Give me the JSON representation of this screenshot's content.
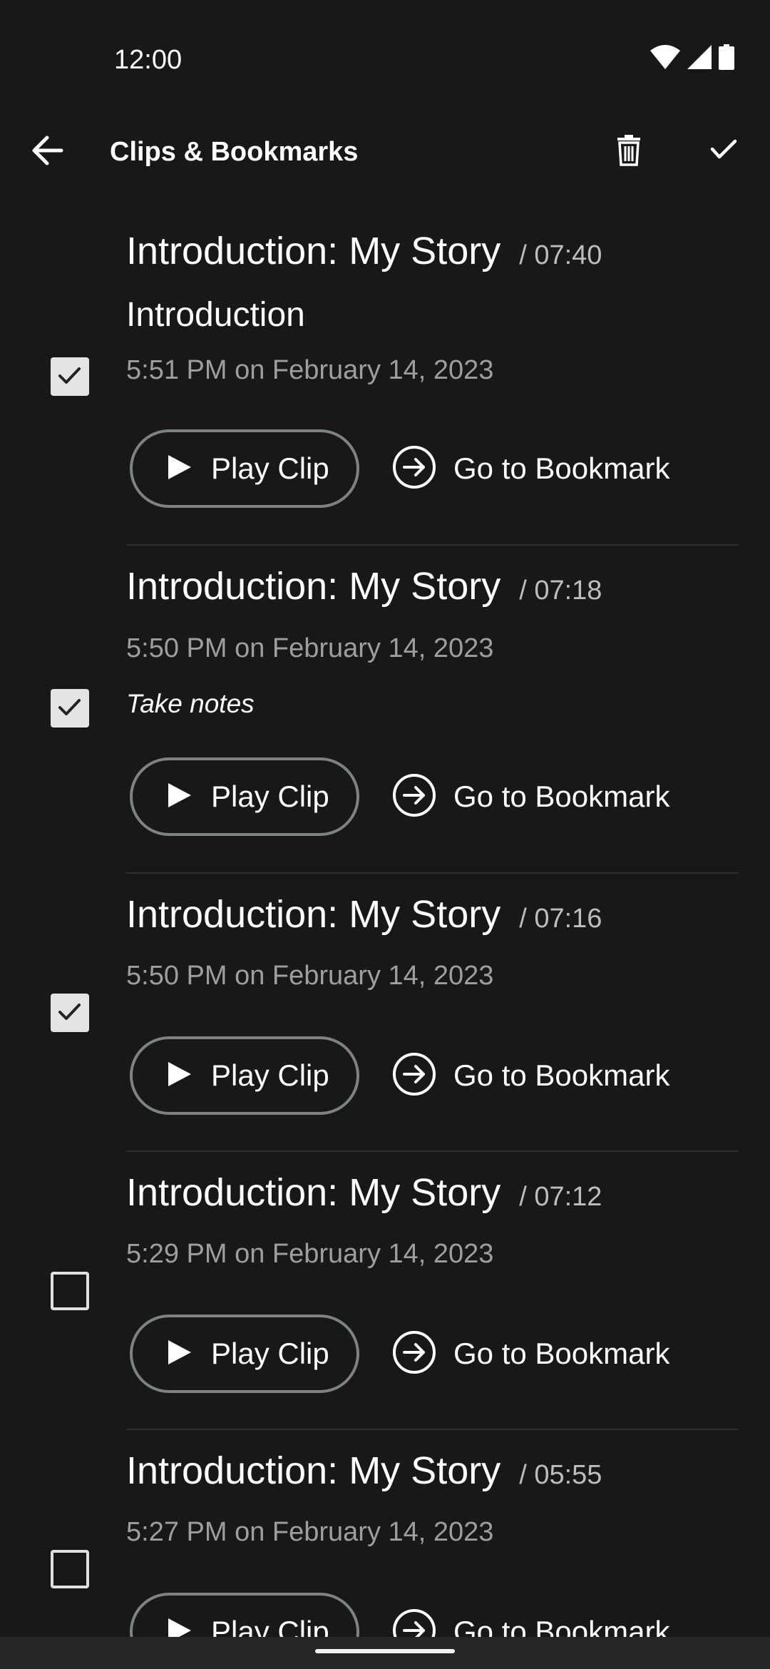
{
  "status_bar": {
    "time": "12:00"
  },
  "app_bar": {
    "title": "Clips & Bookmarks"
  },
  "colors": {
    "background": "#181818",
    "button_outline": "#7b8480",
    "secondary_text": "#9e9e9e"
  },
  "clips": [
    {
      "title": "Introduction: My Story",
      "duration": "/ 07:40",
      "name": "Introduction",
      "timestamp": "5:51 PM on February 14, 2023",
      "note": "",
      "checked": true,
      "play_label": "Play Clip",
      "bookmark_label": "Go to Bookmark"
    },
    {
      "title": "Introduction: My Story",
      "duration": "/ 07:18",
      "name": "",
      "timestamp": "5:50 PM on February 14, 2023",
      "note": "Take notes",
      "checked": true,
      "play_label": "Play Clip",
      "bookmark_label": "Go to Bookmark"
    },
    {
      "title": "Introduction: My Story",
      "duration": "/ 07:16",
      "name": "",
      "timestamp": "5:50 PM on February 14, 2023",
      "note": "",
      "checked": true,
      "play_label": "Play Clip",
      "bookmark_label": "Go to Bookmark"
    },
    {
      "title": "Introduction: My Story",
      "duration": "/ 07:12",
      "name": "",
      "timestamp": "5:29 PM on February 14, 2023",
      "note": "",
      "checked": false,
      "play_label": "Play Clip",
      "bookmark_label": "Go to Bookmark"
    },
    {
      "title": "Introduction: My Story",
      "duration": "/ 05:55",
      "name": "",
      "timestamp": "5:27 PM on February 14, 2023",
      "note": "",
      "checked": false,
      "play_label": "Play Clip",
      "bookmark_label": "Go to Bookmark"
    }
  ]
}
